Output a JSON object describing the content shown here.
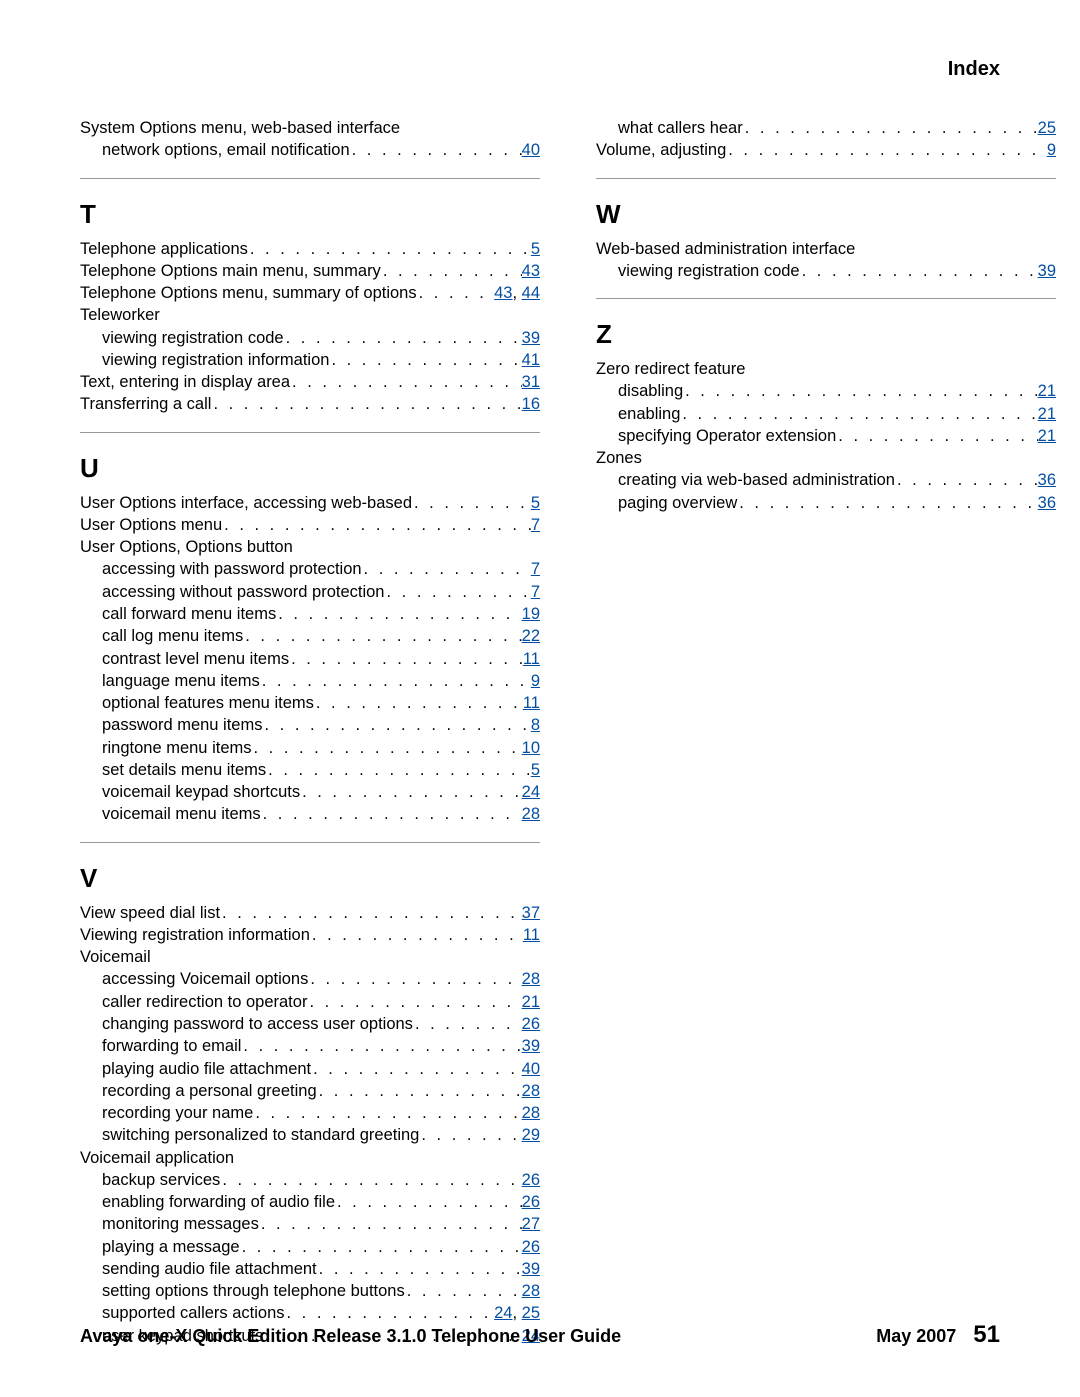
{
  "header": {
    "title": "Index"
  },
  "footer": {
    "left": "Avaya one-X Quick Edition Release 3.1.0 Telephone User Guide",
    "date": "May 2007",
    "page": "51"
  },
  "left_col": [
    {
      "kind": "headline",
      "text": "System Options menu, web-based interface"
    },
    {
      "kind": "sub",
      "text": "network options, email notification",
      "pages": [
        "40"
      ]
    },
    {
      "kind": "rule"
    },
    {
      "kind": "letter",
      "text": "T"
    },
    {
      "kind": "line",
      "text": "Telephone applications",
      "pages": [
        "5"
      ]
    },
    {
      "kind": "line",
      "text": "Telephone Options main menu, summary",
      "pages": [
        "43"
      ]
    },
    {
      "kind": "line",
      "text": "Telephone Options menu, summary of options",
      "pages": [
        "43",
        "44"
      ]
    },
    {
      "kind": "headline",
      "text": "Teleworker"
    },
    {
      "kind": "sub",
      "text": "viewing registration code",
      "pages": [
        "39"
      ]
    },
    {
      "kind": "sub",
      "text": "viewing registration information",
      "pages": [
        "41"
      ]
    },
    {
      "kind": "line",
      "text": "Text, entering in display area",
      "pages": [
        "31"
      ]
    },
    {
      "kind": "line",
      "text": "Transferring a call",
      "pages": [
        "16"
      ]
    },
    {
      "kind": "rule"
    },
    {
      "kind": "letter",
      "text": "U"
    },
    {
      "kind": "line",
      "text": "User Options interface, accessing web-based",
      "pages": [
        "5"
      ]
    },
    {
      "kind": "line",
      "text": "User Options menu",
      "pages": [
        "7"
      ]
    },
    {
      "kind": "headline",
      "text": "User Options, Options button"
    },
    {
      "kind": "sub",
      "text": "accessing with password protection",
      "pages": [
        "7"
      ]
    },
    {
      "kind": "sub",
      "text": "accessing without password protection",
      "pages": [
        "7"
      ]
    },
    {
      "kind": "sub",
      "text": "call forward menu items",
      "pages": [
        "19"
      ]
    },
    {
      "kind": "sub",
      "text": "call log menu items",
      "pages": [
        "22"
      ]
    },
    {
      "kind": "sub",
      "text": "contrast level menu items",
      "pages": [
        "11"
      ]
    },
    {
      "kind": "sub",
      "text": "language menu items",
      "pages": [
        "9"
      ]
    },
    {
      "kind": "sub",
      "text": "optional features menu items",
      "pages": [
        "11"
      ]
    },
    {
      "kind": "sub",
      "text": "password menu items",
      "pages": [
        "8"
      ]
    },
    {
      "kind": "sub",
      "text": "ringtone menu items",
      "pages": [
        "10"
      ]
    },
    {
      "kind": "sub",
      "text": "set details menu items",
      "pages": [
        "5"
      ]
    },
    {
      "kind": "sub",
      "text": "voicemail keypad shortcuts",
      "pages": [
        "24"
      ]
    },
    {
      "kind": "sub",
      "text": "voicemail menu items",
      "pages": [
        "28"
      ]
    },
    {
      "kind": "rule"
    },
    {
      "kind": "letter",
      "text": "V"
    },
    {
      "kind": "line",
      "text": "View speed dial list",
      "pages": [
        "37"
      ]
    },
    {
      "kind": "line",
      "text": "Viewing registration information",
      "pages": [
        "11"
      ]
    },
    {
      "kind": "headline",
      "text": "Voicemail"
    },
    {
      "kind": "sub",
      "text": "accessing Voicemail options",
      "pages": [
        "28"
      ]
    },
    {
      "kind": "sub",
      "text": "caller redirection to operator",
      "pages": [
        "21"
      ]
    },
    {
      "kind": "sub",
      "text": "changing password to access user options",
      "pages": [
        "26"
      ]
    },
    {
      "kind": "sub",
      "text": "forwarding to email",
      "pages": [
        "39"
      ]
    },
    {
      "kind": "sub",
      "text": "playing audio file attachment",
      "pages": [
        "40"
      ]
    },
    {
      "kind": "sub",
      "text": "recording a personal greeting",
      "pages": [
        "28"
      ]
    },
    {
      "kind": "sub",
      "text": "recording your name",
      "pages": [
        "28"
      ]
    },
    {
      "kind": "sub",
      "text": "switching personalized to standard greeting",
      "pages": [
        "29"
      ]
    },
    {
      "kind": "headline",
      "text": "Voicemail application"
    },
    {
      "kind": "sub",
      "text": "backup services",
      "pages": [
        "26"
      ]
    },
    {
      "kind": "sub",
      "text": "enabling forwarding of audio file",
      "pages": [
        "26"
      ]
    },
    {
      "kind": "sub",
      "text": "monitoring messages",
      "pages": [
        "27"
      ]
    },
    {
      "kind": "sub",
      "text": "playing a message",
      "pages": [
        "26"
      ]
    },
    {
      "kind": "sub",
      "text": "sending audio file attachment",
      "pages": [
        "39"
      ]
    },
    {
      "kind": "sub",
      "text": "setting options through telephone buttons",
      "pages": [
        "28"
      ]
    },
    {
      "kind": "sub",
      "text": "supported callers actions",
      "pages": [
        "24",
        "25"
      ]
    },
    {
      "kind": "sub",
      "text": "user keypad shortcuts",
      "pages": [
        "24"
      ]
    }
  ],
  "right_col": [
    {
      "kind": "sub",
      "text": "what callers hear",
      "pages": [
        "25"
      ]
    },
    {
      "kind": "line",
      "text": "Volume, adjusting",
      "pages": [
        "9"
      ]
    },
    {
      "kind": "rule"
    },
    {
      "kind": "letter",
      "text": "W"
    },
    {
      "kind": "headline",
      "text": "Web-based administration interface"
    },
    {
      "kind": "sub",
      "text": "viewing registration code",
      "pages": [
        "39"
      ]
    },
    {
      "kind": "rule"
    },
    {
      "kind": "letter",
      "text": "Z"
    },
    {
      "kind": "headline",
      "text": "Zero redirect feature"
    },
    {
      "kind": "sub",
      "text": "disabling",
      "pages": [
        "21"
      ]
    },
    {
      "kind": "sub",
      "text": "enabling",
      "pages": [
        "21"
      ]
    },
    {
      "kind": "sub",
      "text": "specifying Operator extension",
      "pages": [
        "21"
      ]
    },
    {
      "kind": "headline",
      "text": "Zones"
    },
    {
      "kind": "sub",
      "text": "creating via web-based administration",
      "pages": [
        "36"
      ]
    },
    {
      "kind": "sub",
      "text": "paging overview",
      "pages": [
        "36"
      ]
    }
  ]
}
